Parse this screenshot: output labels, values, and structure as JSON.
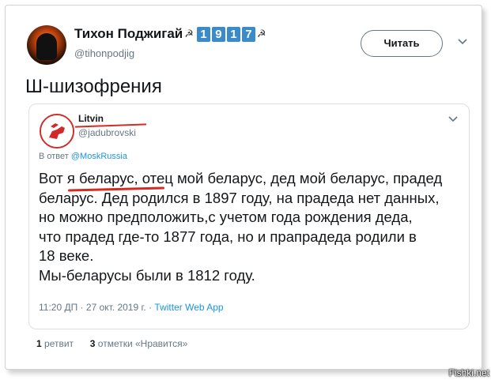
{
  "tweet": {
    "author_name": "Тихон Поджигай",
    "name_symbol": "☭",
    "name_digits": [
      "1",
      "9",
      "1",
      "7"
    ],
    "handle": "@tihonpodjig",
    "follow_label": "Читать",
    "text": "Ш-шизофрения"
  },
  "quoted": {
    "author_name": "Litvin",
    "handle": "@jadubrovski",
    "reply_prefix": "В ответ",
    "reply_mention": "@MoskRussia",
    "lines": [
      "Вот я беларус, отец мой беларус, дед мой беларус, прадед",
      "беларус. Дед родился в 1897 году, на прадеда нет данных,",
      "но можно предположить,с учетом года рождения деда,",
      "что прадед где-то 1877 года, но и прапрадеда  родили в",
      "18 веке.",
      "Мы-беларусы были в 1812 году."
    ],
    "timestamp": "11:20 ДП · 27 окт. 2019 г. · ",
    "source": "Twitter Web App"
  },
  "stats": {
    "retweets_count": "1",
    "retweets_label": "ретвит",
    "likes_count": "3",
    "likes_label": "отметки «Нравится»"
  },
  "watermark": "Fishki.net",
  "colors": {
    "accent_blue": "#1b95e0",
    "underline_red": "#d62b22",
    "digit_blue": "#3b8bc9"
  }
}
